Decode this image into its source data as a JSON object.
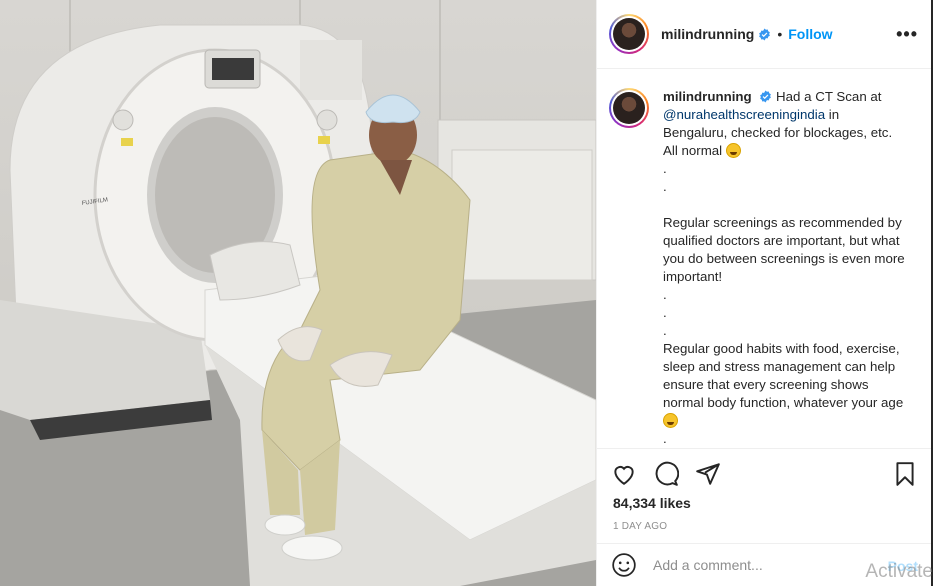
{
  "post": {
    "username": "milindrunning",
    "follow_label": "Follow",
    "separator": "•",
    "more_label": "•••"
  },
  "caption": {
    "username": "milindrunning",
    "line1": "Had a CT Scan at",
    "mention": "@nurahealthscreeningindia",
    "line2": " in Bengaluru, checked for blockages, etc. All normal",
    "dot": ".",
    "para2": "Regular screenings as recommended by qualified doctors are important, but what you do between screenings is even more important!",
    "para3": "Regular good habits with food, exercise, sleep and stress management can help ensure that every screening shows normal body function, whatever your age"
  },
  "photo": {
    "machine_brand": "FUJIFILM"
  },
  "engagement": {
    "likes": "84,334 likes",
    "date": "1 DAY AGO"
  },
  "comment": {
    "placeholder": "Add a comment...",
    "post_label": "Post"
  },
  "overlay": {
    "watermark": "Activate"
  },
  "colors": {
    "link_blue": "#0095f6",
    "mention_blue": "#00376b",
    "muted": "#8e8e8e"
  },
  "icons": [
    "verified-badge-icon",
    "heart-icon",
    "comment-icon",
    "share-icon",
    "bookmark-icon",
    "emoji-icon",
    "more-options-icon"
  ]
}
